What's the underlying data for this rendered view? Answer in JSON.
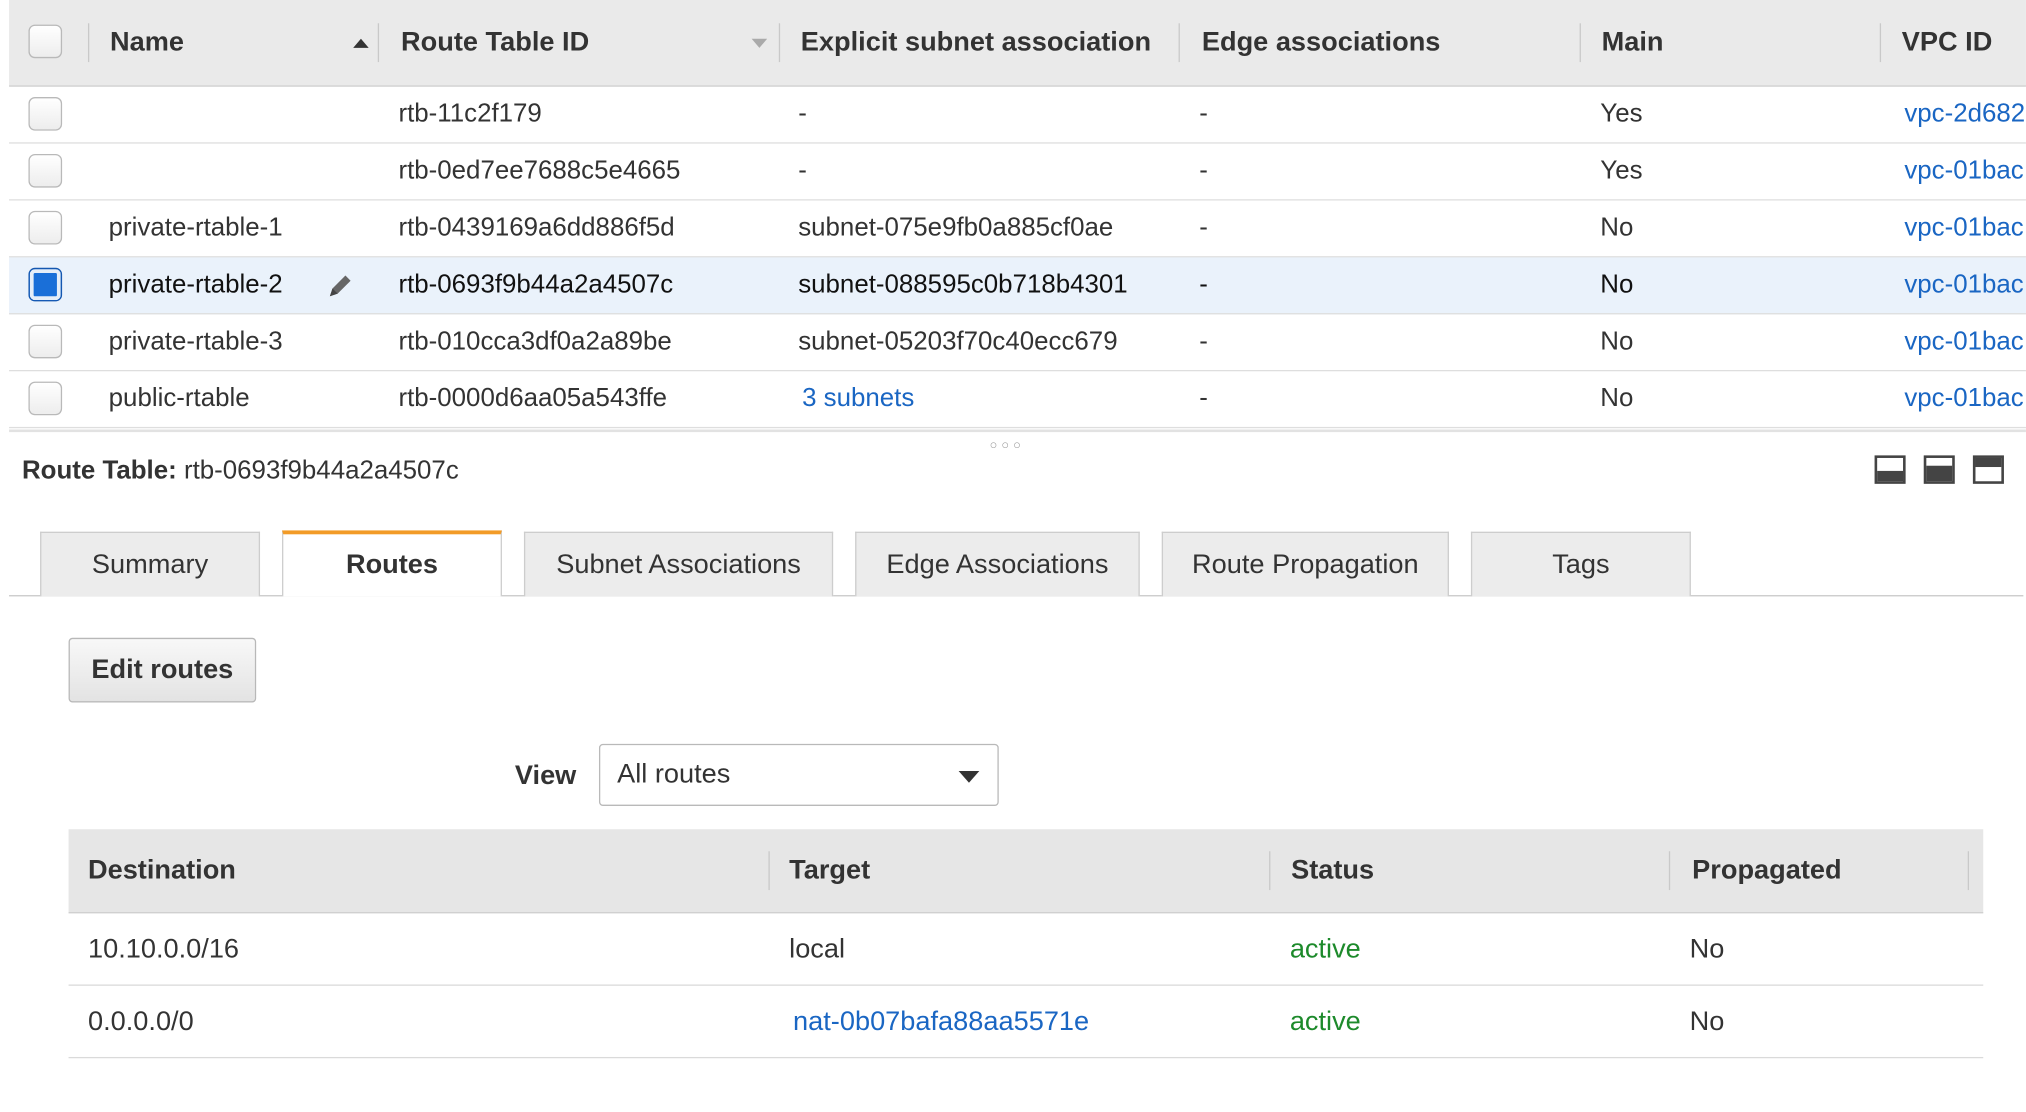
{
  "top_table": {
    "headers": {
      "name": "Name",
      "route_table_id": "Route Table ID",
      "explicit_subnet": "Explicit subnet association",
      "edge": "Edge associations",
      "main": "Main",
      "vpc_id": "VPC ID"
    },
    "rows": [
      {
        "name": "",
        "id": "rtb-11c2f179",
        "subnet": "-",
        "edge": "-",
        "main": "Yes",
        "vpc": "vpc-2d682",
        "selected": false
      },
      {
        "name": "",
        "id": "rtb-0ed7ee7688c5e4665",
        "subnet": "-",
        "edge": "-",
        "main": "Yes",
        "vpc": "vpc-01bac",
        "selected": false
      },
      {
        "name": "private-rtable-1",
        "id": "rtb-0439169a6dd886f5d",
        "subnet": "subnet-075e9fb0a885cf0ae",
        "edge": "-",
        "main": "No",
        "vpc": "vpc-01bac",
        "selected": false
      },
      {
        "name": "private-rtable-2",
        "id": "rtb-0693f9b44a2a4507c",
        "subnet": "subnet-088595c0b718b4301",
        "edge": "-",
        "main": "No",
        "vpc": "vpc-01bac",
        "selected": true
      },
      {
        "name": "private-rtable-3",
        "id": "rtb-010cca3df0a2a89be",
        "subnet": "subnet-05203f70c40ecc679",
        "edge": "-",
        "main": "No",
        "vpc": "vpc-01bac",
        "selected": false
      },
      {
        "name": "public-rtable",
        "id": "rtb-0000d6aa05a543ffe",
        "subnet": "3 subnets",
        "edge": "-",
        "main": "No",
        "vpc": "vpc-01bac",
        "selected": false
      }
    ]
  },
  "detail": {
    "label": "Route Table:",
    "value": "rtb-0693f9b44a2a4507c"
  },
  "tabs": [
    {
      "label": "Summary"
    },
    {
      "label": "Routes"
    },
    {
      "label": "Subnet Associations"
    },
    {
      "label": "Edge Associations"
    },
    {
      "label": "Route Propagation"
    },
    {
      "label": "Tags"
    }
  ],
  "active_tab": "Routes",
  "routes_panel": {
    "edit_button": "Edit routes",
    "view_label": "View",
    "view_value": "All routes",
    "headers": {
      "destination": "Destination",
      "target": "Target",
      "status": "Status",
      "propagated": "Propagated"
    },
    "rows": [
      {
        "destination": "10.10.0.0/16",
        "target": "local",
        "status": "active",
        "propagated": "No"
      },
      {
        "destination": "0.0.0.0/0",
        "target": "nat-0b07bafa88aa5571e",
        "status": "active",
        "propagated": "No"
      }
    ]
  },
  "colors": {
    "link": "#1a66c3",
    "active_status": "#1d8a2b",
    "tab_accent": "#f29b27",
    "selected_row": "#eaf2fb",
    "checkbox_checked": "#1a6fd8"
  }
}
